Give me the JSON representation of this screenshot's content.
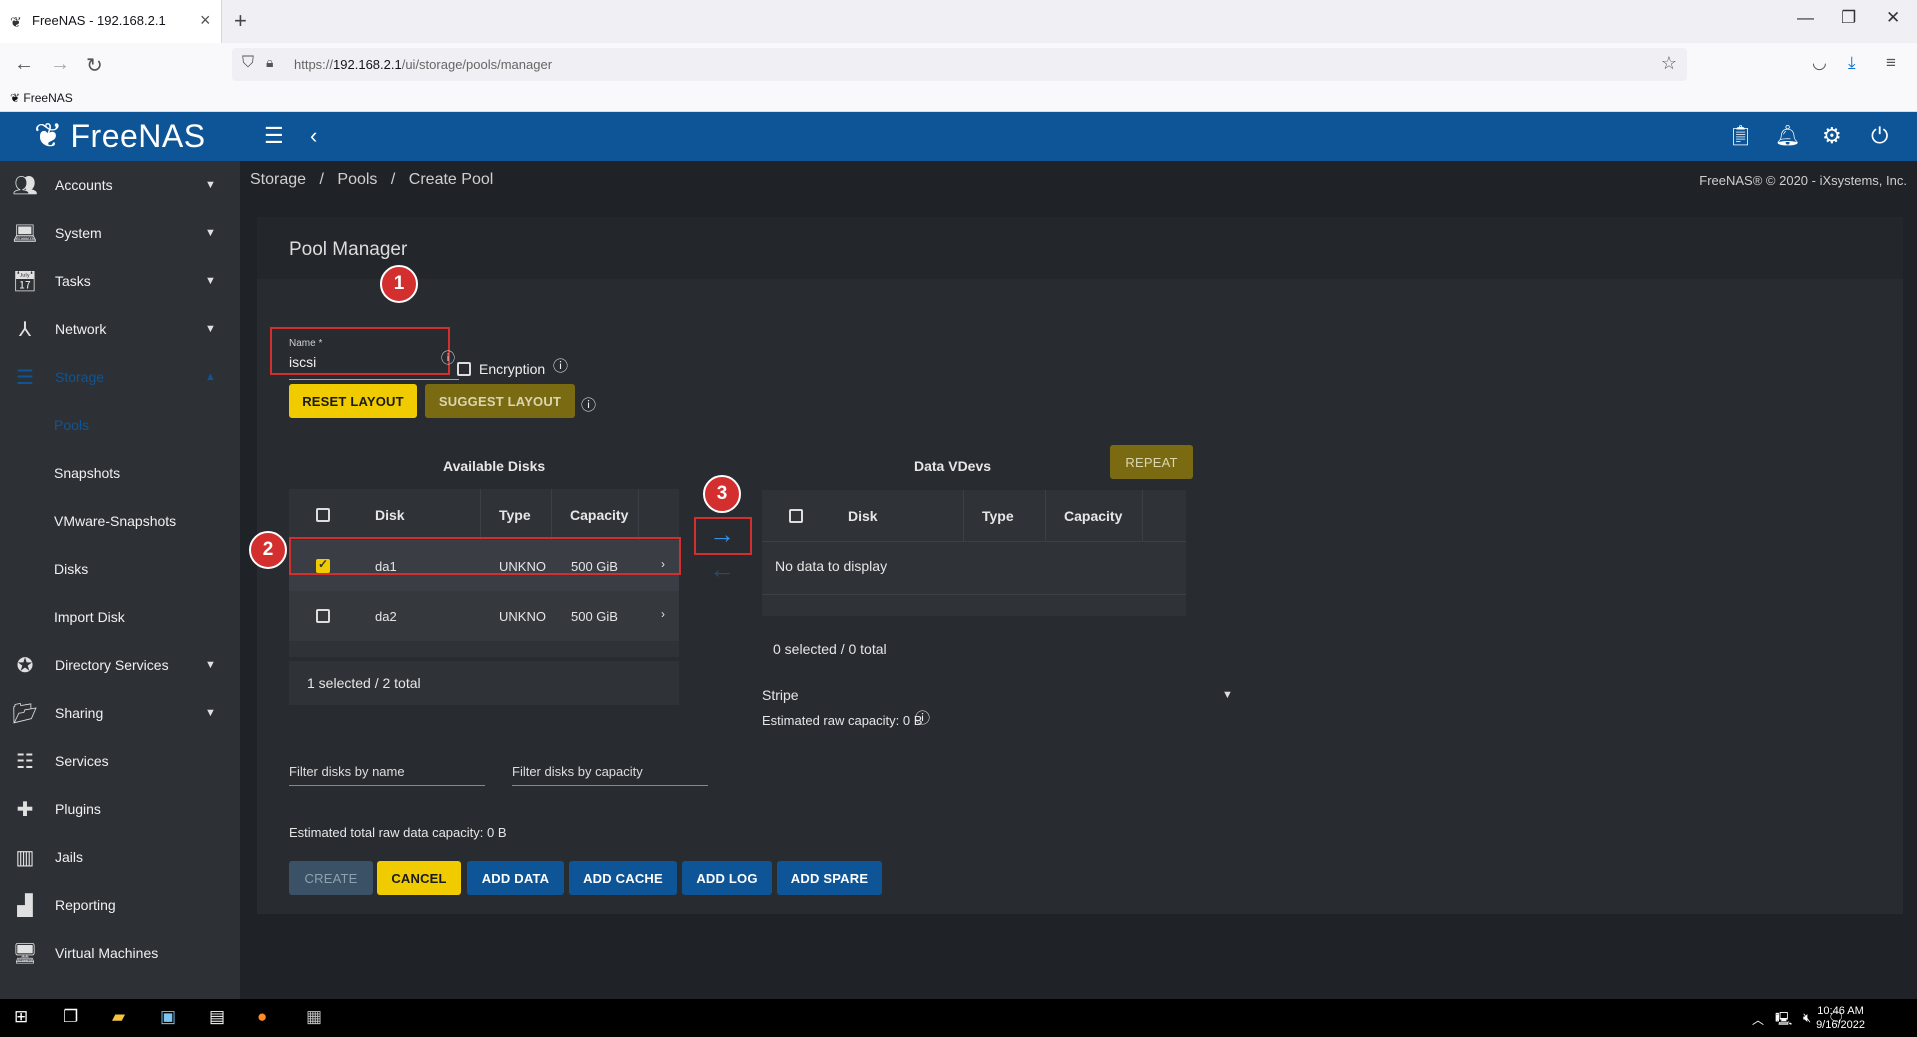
{
  "browser": {
    "tab_title": "FreeNAS - 192.168.2.1",
    "url_prefix": "https://",
    "url_host": "192.168.2.1",
    "url_path": "/ui/storage/pools/manager",
    "bookmark": "FreeNAS"
  },
  "app": {
    "logo_text": "FreeNAS",
    "copyright": "FreeNAS® © 2020 - iXsystems, Inc."
  },
  "sidebar": {
    "items": [
      {
        "label": "Accounts",
        "icon": "people-icon"
      },
      {
        "label": "System",
        "icon": "laptop-icon"
      },
      {
        "label": "Tasks",
        "icon": "calendar-icon"
      },
      {
        "label": "Network",
        "icon": "network-icon"
      },
      {
        "label": "Storage",
        "icon": "storage-icon"
      },
      {
        "label": "Pools"
      },
      {
        "label": "Snapshots"
      },
      {
        "label": "VMware-Snapshots"
      },
      {
        "label": "Disks"
      },
      {
        "label": "Import Disk"
      },
      {
        "label": "Directory Services",
        "icon": "directory-icon"
      },
      {
        "label": "Sharing",
        "icon": "folder-share-icon"
      },
      {
        "label": "Services",
        "icon": "tune-icon"
      },
      {
        "label": "Plugins",
        "icon": "puzzle-icon"
      },
      {
        "label": "Jails",
        "icon": "jail-icon"
      },
      {
        "label": "Reporting",
        "icon": "chart-icon"
      },
      {
        "label": "Virtual Machines",
        "icon": "monitor-icon"
      }
    ]
  },
  "breadcrumb": {
    "a": "Storage",
    "b": "Pools",
    "c": "Create Pool"
  },
  "pool_manager": {
    "title": "Pool Manager",
    "name_label": "Name *",
    "name_value": "iscsi",
    "encryption_label": "Encryption",
    "reset_layout": "RESET LAYOUT",
    "suggest_layout": "SUGGEST LAYOUT",
    "available_title": "Available Disks",
    "vdevs_title": "Data VDevs",
    "repeat": "REPEAT",
    "columns": {
      "disk": "Disk",
      "type": "Type",
      "capacity": "Capacity"
    },
    "disks": [
      {
        "name": "da1",
        "type": "UNKNO",
        "capacity": "500 GiB",
        "checked": true
      },
      {
        "name": "da2",
        "type": "UNKNO",
        "capacity": "500 GiB",
        "checked": false
      }
    ],
    "available_footer": "1 selected / 2 total",
    "no_data": "No data to display",
    "vdev_footer": "0 selected / 0 total",
    "stripe": "Stripe",
    "est_raw": "Estimated raw capacity: 0 B",
    "filter_name": "Filter disks by name",
    "filter_capacity": "Filter disks by capacity",
    "est_total": "Estimated total raw data capacity: 0 B",
    "buttons": {
      "create": "CREATE",
      "cancel": "CANCEL",
      "add_data": "ADD DATA",
      "add_cache": "ADD CACHE",
      "add_log": "ADD LOG",
      "add_spare": "ADD SPARE"
    },
    "annotations": [
      "1",
      "2",
      "3"
    ]
  },
  "taskbar": {
    "time": "10:46 AM",
    "date": "9/16/2022"
  }
}
